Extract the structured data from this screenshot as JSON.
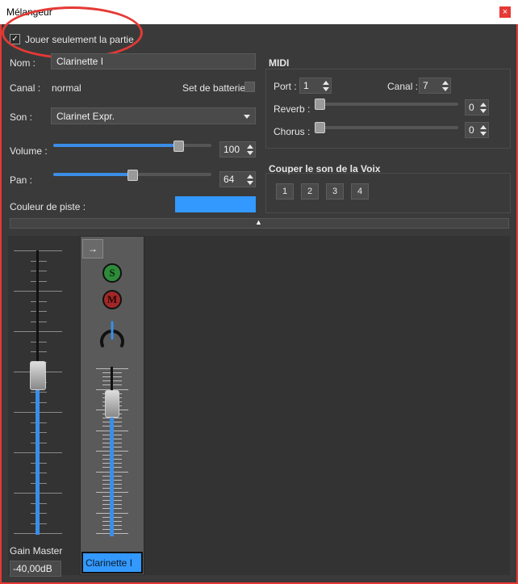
{
  "window": {
    "title": "Mélangeur",
    "close_glyph": "×"
  },
  "part": {
    "solo_checked": true,
    "solo_label": "Jouer seulement la partie",
    "name_label": "Nom :",
    "name_value": "Clarinette I",
    "channel_label": "Canal :",
    "channel_value": "normal",
    "drumset_label": "Set de batterie",
    "sound_label": "Son :",
    "sound_value": "Clarinet Expr.",
    "volume_label": "Volume :",
    "volume_value": "100",
    "volume_level": 0.79,
    "pan_label": "Pan :",
    "pan_value": "64",
    "pan_level": 0.5,
    "color_label": "Couleur de piste :",
    "color_value": "#3399ff"
  },
  "midi": {
    "heading": "MIDI",
    "port_label": "Port :",
    "port_value": "1",
    "channel_label": "Canal :",
    "channel_value": "7",
    "reverb_label": "Reverb :",
    "reverb_value": "0",
    "chorus_label": "Chorus :",
    "chorus_value": "0"
  },
  "voices": {
    "heading": "Couper le son de la Voix",
    "buttons": [
      "1",
      "2",
      "3",
      "4"
    ]
  },
  "collapse_glyph": "▲",
  "master": {
    "label": "Gain Master",
    "value": "-40,00dB",
    "level": 0.56
  },
  "channel_strip": {
    "expand_glyph": "→",
    "solo_label": "S",
    "mute_label": "M",
    "name": "Clarinette I",
    "fader_level": 0.78
  },
  "annotation_color": "#e53935"
}
